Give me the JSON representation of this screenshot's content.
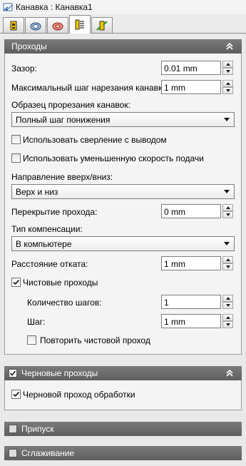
{
  "window": {
    "title": "Канавка : Канавка1"
  },
  "tabs": [
    {
      "icon": "tool-icon",
      "active": false
    },
    {
      "icon": "holder-icon",
      "active": false
    },
    {
      "icon": "parameters-icon",
      "active": false
    },
    {
      "icon": "passes-icon",
      "active": true
    },
    {
      "icon": "linking-icon",
      "active": false
    }
  ],
  "passes": {
    "header": "Проходы",
    "clearance": {
      "label": "Зазор:",
      "value": "0.01 mm"
    },
    "max_stepdown": {
      "label": "Максимальный шаг нарезания канавки:",
      "value": "1 mm"
    },
    "groove_pattern": {
      "label": "Образец прорезания канавок:",
      "value": "Полный шаг понижения"
    },
    "use_pecking": {
      "label": "Использовать сверление с выводом",
      "checked": false
    },
    "use_reduced_feed": {
      "label": "Использовать уменьшенную скорость подачи",
      "checked": false
    },
    "direction": {
      "label": "Направление вверх/вниз:",
      "value": "Верх и низ"
    },
    "pass_overlap": {
      "label": "Перекрытие прохода:",
      "value": "0 mm"
    },
    "compensation_type": {
      "label": "Тип компенсации:",
      "value": "В компьютере"
    },
    "retract_distance": {
      "label": "Расстояние отката:",
      "value": "1 mm"
    },
    "finish_passes": {
      "label": "Чистовые проходы",
      "checked": true
    },
    "number_of_steps": {
      "label": "Количество шагов:",
      "value": "1"
    },
    "step": {
      "label": "Шаг:",
      "value": "1 mm"
    },
    "repeat_finish": {
      "label": "Повторить чистовой проход",
      "checked": false
    }
  },
  "rough_passes": {
    "header": "Черновые проходы",
    "checked": true,
    "rough_finishing_pass": {
      "label": "Черновой проход обработки",
      "checked": true
    }
  },
  "stock": {
    "header": "Припуск",
    "checked": false
  },
  "smoothing": {
    "header": "Сглаживание",
    "checked": false
  }
}
